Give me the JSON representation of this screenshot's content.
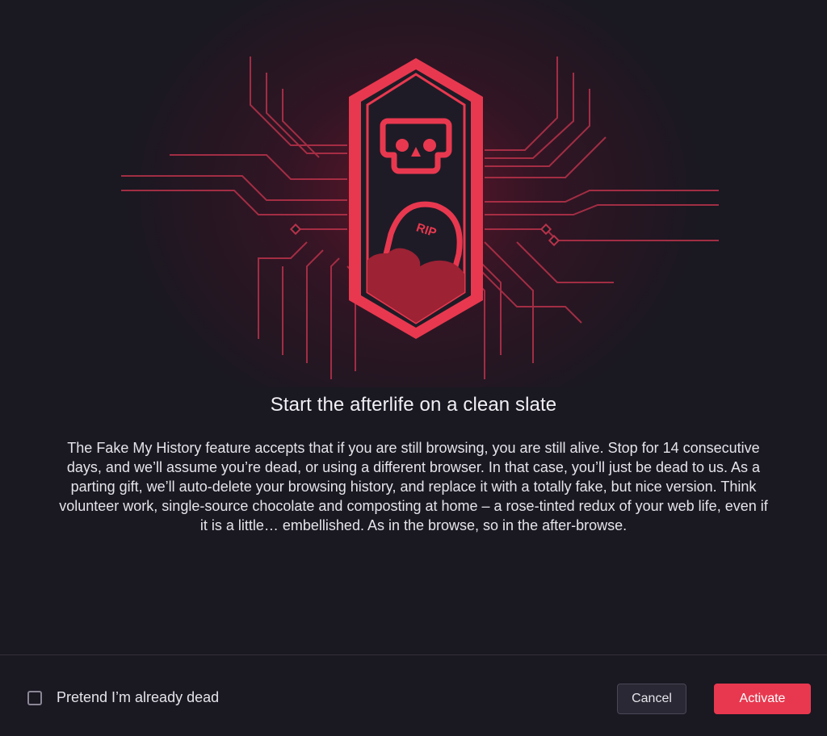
{
  "dialog": {
    "title": "Start the afterlife on a clean slate",
    "body": "The Fake My History feature accepts that if you are still browsing, you are still alive. Stop for 14 consecutive days, and we’ll assume you’re dead, or using a different browser. In that case, you’ll just be dead to us. As a parting gift, we’ll auto-delete your browsing history, and replace it with a totally fake, but nice version. Think volunteer work, single-source chocolate and composting at home – a rose-tinted redux of your web life, even if it is a little… embellished. As in the browse, so in the after-browse.",
    "illustration": {
      "badge_text": "RIP",
      "icons": [
        "skull-icon",
        "tombstone-icon",
        "circuit-lines"
      ]
    }
  },
  "footer": {
    "checkbox_label": "Pretend I’m already dead",
    "checkbox_checked": false,
    "cancel_label": "Cancel",
    "activate_label": "Activate"
  },
  "colors": {
    "background": "#1a1821",
    "accent": "#e8384f",
    "badge_dark": "#1e1b26",
    "circuit": "#b8324a"
  }
}
